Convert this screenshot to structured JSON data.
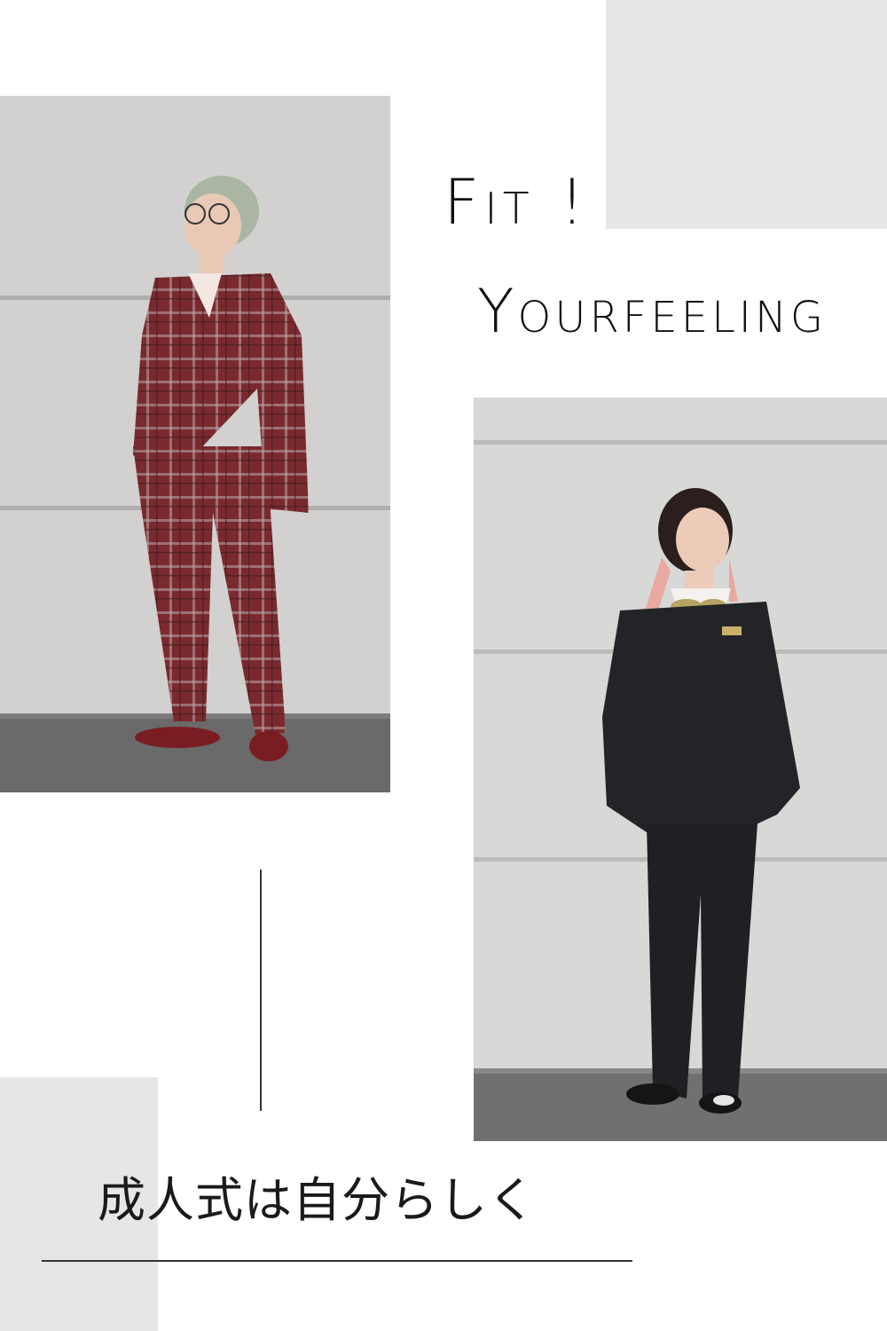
{
  "headline": {
    "line1": "Fit !",
    "line2": "Yourfeeling"
  },
  "tagline": "成人式は自分らしく",
  "colors": {
    "background": "#ffffff",
    "accent_block": "#e7e6e4",
    "text": "#111111",
    "plaid_suit": "#7a2a2e",
    "black_suit": "#232427",
    "wall": "#cfcfcf"
  },
  "photos": {
    "left": {
      "subject": "person-in-red-plaid-three-piece-suit"
    },
    "right": {
      "subject": "person-in-black-double-breasted-suit"
    }
  }
}
